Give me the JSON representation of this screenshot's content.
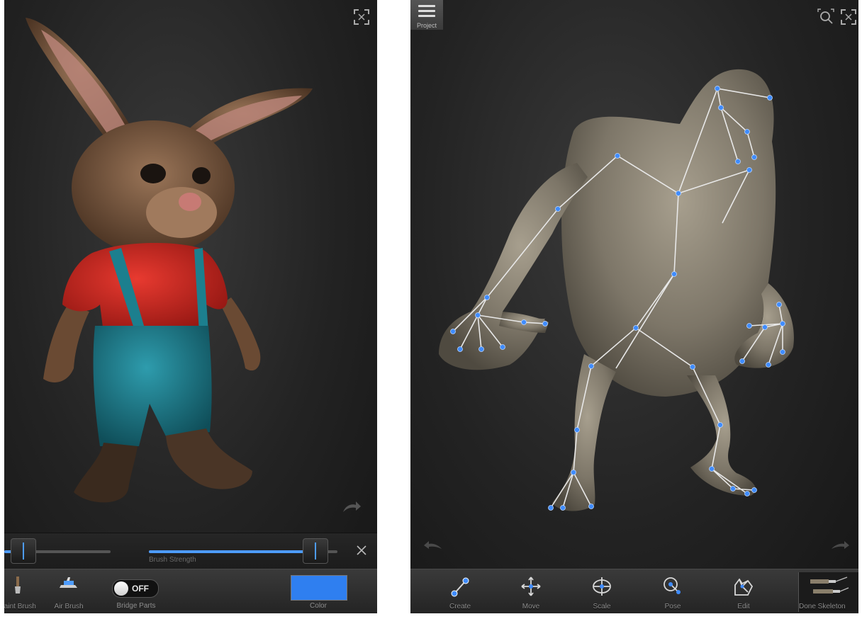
{
  "left_panel": {
    "slider_label": "Brush Strength",
    "tools": [
      {
        "label": "Paint Brush",
        "icon": "brush-icon"
      },
      {
        "label": "Air Brush",
        "icon": "airbrush-icon"
      }
    ],
    "toggle": {
      "label": "Bridge Parts",
      "state": "OFF"
    },
    "color_label": "Color",
    "color_value": "#2f7ff0",
    "strength_level": 0.88
  },
  "right_panel": {
    "menu_label": "Project",
    "tools": [
      {
        "label": "Create",
        "icon": "create-bone-icon"
      },
      {
        "label": "Move",
        "icon": "move-icon"
      },
      {
        "label": "Scale",
        "icon": "scale-icon"
      },
      {
        "label": "Pose",
        "icon": "pose-icon"
      },
      {
        "label": "Edit",
        "icon": "edit-icon"
      },
      {
        "label": "Done Skeleton",
        "icon": "done-skeleton-icon"
      }
    ]
  },
  "colors": {
    "accent": "#4d9cff",
    "joint": "#3f8cff",
    "bone": "#e8e8e8",
    "background": "#232323"
  }
}
